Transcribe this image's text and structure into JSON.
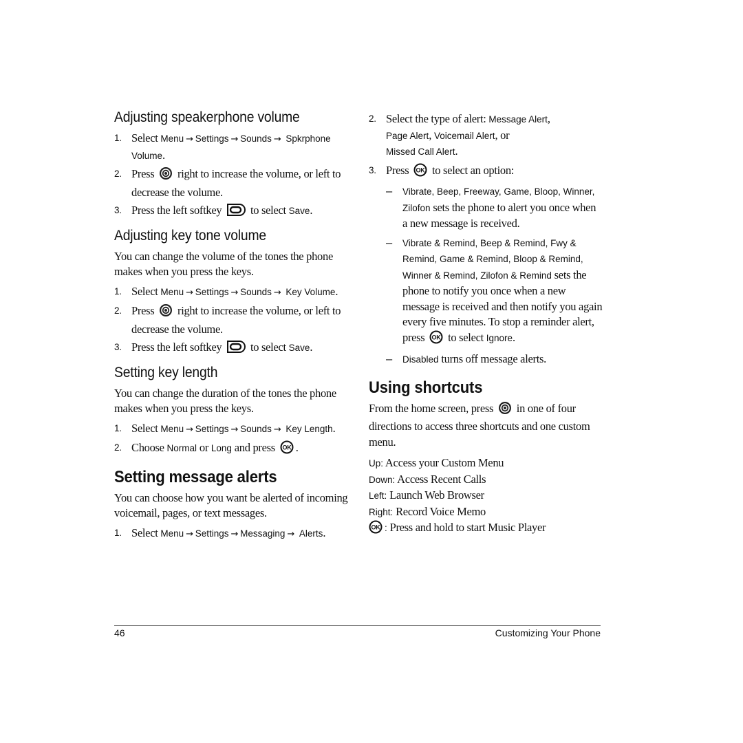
{
  "page": {
    "number": "46",
    "chapter": "Customizing Your Phone"
  },
  "arrow": "→",
  "dash": "–",
  "icons": {
    "nav_key": "navigation-key-icon",
    "left_softkey": "left-softkey-icon",
    "ok_key": "ok-key-icon"
  },
  "speakerphone": {
    "heading": "Adjusting speakerphone volume",
    "steps": [
      {
        "num": "1.",
        "pre": "Select ",
        "path": [
          "Menu",
          "Settings",
          "Sounds",
          "Spkrphone Volume"
        ],
        "post": "."
      },
      {
        "num": "2.",
        "pre": "Press ",
        "post": " right to increase the volume, or left to decrease the volume."
      },
      {
        "num": "3.",
        "pre": "Press the left softkey ",
        "mid": " to select ",
        "ui": "Save",
        "post": "."
      }
    ]
  },
  "keytone": {
    "heading": "Adjusting key tone volume",
    "intro": "You can change the volume of the tones the phone makes when you press the keys.",
    "steps": [
      {
        "num": "1.",
        "pre": "Select ",
        "path": [
          "Menu",
          "Settings",
          "Sounds",
          "Key Volume"
        ],
        "post": "."
      },
      {
        "num": "2.",
        "pre": "Press ",
        "post": " right to increase the volume, or left to decrease the volume."
      },
      {
        "num": "3.",
        "pre": "Press the left softkey ",
        "mid": " to select ",
        "ui": "Save",
        "post": "."
      }
    ]
  },
  "keylength": {
    "heading": "Setting key length",
    "intro": "You can change the duration of the tones the phone makes when you press the keys.",
    "steps": [
      {
        "num": "1.",
        "pre": "Select ",
        "path": [
          "Menu",
          "Settings",
          "Sounds",
          "Key Length"
        ],
        "post": "."
      },
      {
        "num": "2.",
        "pre": "Choose ",
        "ui1": "Normal",
        "mid": " or ",
        "ui2": "Long",
        "mid2": " and press ",
        "post": "."
      }
    ]
  },
  "alerts": {
    "heading": "Setting message alerts",
    "intro": "You can choose how you want be alerted of incoming voicemail, pages, or text messages.",
    "steps": [
      {
        "num": "1.",
        "pre": "Select ",
        "path": [
          "Menu",
          "Settings",
          "Messaging",
          "Alerts"
        ],
        "post": "."
      },
      {
        "num": "2.",
        "pre": "Select the type of alert: ",
        "ui1": "Message Alert",
        "sep1": ", ",
        "ui2": "Page Alert",
        "sep2": ", ",
        "ui3": "Voicemail Alert",
        "sep3": ", or ",
        "ui4": "Missed Call Alert",
        "post": "."
      },
      {
        "num": "3.",
        "pre": "Press ",
        "post": " to select an option:"
      }
    ],
    "options": [
      {
        "ui": "Vibrate, Beep, Freeway, Game, Bloop, Winner, Zilofon",
        "text": " sets the phone to alert you once when a new message is received."
      },
      {
        "ui": "Vibrate & Remind, Beep & Remind, Fwy & Remind, Game & Remind, Bloop & Remind, Winner & Remind, Zilofon & Remind",
        "text": " sets the phone to notify you once when a new message is received and then notify you again every five minutes. To stop a reminder alert, press ",
        "text2": " to select ",
        "ui2": "Ignore",
        "post": "."
      },
      {
        "ui": "Disabled",
        "text": " turns off message alerts."
      }
    ]
  },
  "shortcuts": {
    "heading": "Using shortcuts",
    "intro_pre": "From the home screen, press ",
    "intro_post": " in one of four directions to access three shortcuts and one custom menu.",
    "items": [
      {
        "key": "Up:",
        "desc": " Access your Custom Menu"
      },
      {
        "key": "Down:",
        "desc": " Access Recent Calls"
      },
      {
        "key": "Left:",
        "desc": " Launch Web Browser"
      },
      {
        "key": "Right:",
        "desc": " Record Voice Memo"
      }
    ],
    "ok_item": {
      "key": ":",
      "desc": " Press and hold to start Music Player"
    }
  }
}
